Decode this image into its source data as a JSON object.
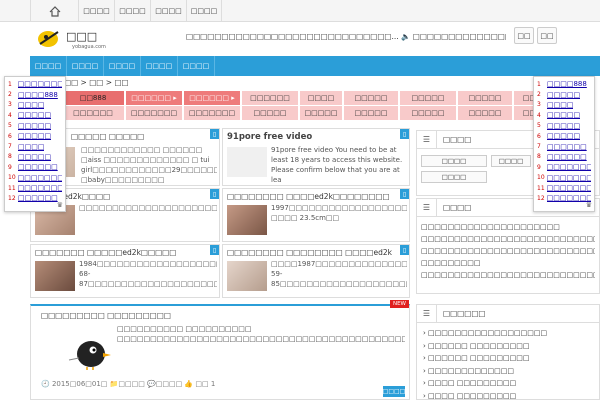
{
  "topnav": {
    "items": [
      "□□□□",
      "□□□□",
      "□□□□",
      "□□□□"
    ]
  },
  "header": {
    "ticker": "□□□□□□□□□□□□□□□□□□□□□□□□□□□□□...  🔈 □□□□□□□□□□□□□□□□□□□□□□□□...",
    "btn1": "□□",
    "btn2": "□□",
    "logo_sub": "yobagua.com"
  },
  "mainnav": {
    "items": [
      "□□□□",
      "□□□□",
      "□□□□",
      "□□□□",
      "□□□□"
    ]
  },
  "left_list": [
    {
      "n": "1",
      "t": "□□□□□□□"
    },
    {
      "n": "2",
      "t": "□□□□888"
    },
    {
      "n": "3",
      "t": "□□□□"
    },
    {
      "n": "4",
      "t": "□□□□□"
    },
    {
      "n": "5",
      "t": "□□□□□"
    },
    {
      "n": "6",
      "t": "□□□□□"
    },
    {
      "n": "7",
      "t": "□□□□"
    },
    {
      "n": "8",
      "t": "□□□□□"
    },
    {
      "n": "9",
      "t": "□□□□□□"
    },
    {
      "n": "10",
      "t": "□□□□□□□"
    },
    {
      "n": "11",
      "t": "□□□□□□□"
    },
    {
      "n": "12",
      "t": "□□□□□□"
    }
  ],
  "right_list": [
    {
      "n": "1",
      "t": "□□□□888"
    },
    {
      "n": "2",
      "t": "□□□□□"
    },
    {
      "n": "3",
      "t": "□□□□"
    },
    {
      "n": "4",
      "t": "□□□□□"
    },
    {
      "n": "5",
      "t": "□□□□□"
    },
    {
      "n": "6",
      "t": "□□□□□"
    },
    {
      "n": "7",
      "t": "□□□□□□"
    },
    {
      "n": "8",
      "t": "□□□□□□"
    },
    {
      "n": "9",
      "t": "□□□□□□□"
    },
    {
      "n": "10",
      "t": "□□□□□□□"
    },
    {
      "n": "11",
      "t": "□□□□□□□"
    },
    {
      "n": "12",
      "t": "□□□□□□□"
    }
  ],
  "breadcrumb": "□□ > □□ > □□",
  "tags_row1": [
    "□□888",
    "□□□□□□ ▸",
    "□□□□□□ ▸",
    "□□□□□□",
    "□□□□",
    "□□□□□",
    "□□□□□",
    "□□□□□",
    "□□□□"
  ],
  "tags_row2": [
    "□□□□□□",
    "□□□□□□□",
    "□□□□□□□",
    "□□□□□",
    "□□□□□",
    "□□□□□",
    "□□□□□",
    "□□□□□",
    "□□□□"
  ],
  "cards": [
    {
      "title": "□□□□□ □□□□□",
      "desc": "□□□□□□□□□□□□ □□□□□□ □aiss □□□□□□□□□□□□□ □ tui girl□□□□□□□□□□□□29□□□□□□□□□□baby□□□□□□□□□□ □baby□□□□□□□□□"
    },
    {
      "title": "91pore free video",
      "desc": "91pore free video You need to be at least 18 years to access this website. Please confirm below that you are at lea"
    },
    {
      "title": "□□□□ed2k□□□□",
      "desc": "□□□□□□□□□□□□□□□□□□□□□□□□□□□□□□□□□□□□□□□□□□□□□□□□□□□□□□□□□□□□□□□□□□□□□□□□□□"
    },
    {
      "title": "□□□□□□□□ □□□□ed2k□□□□□□□□",
      "desc": "1997□□□□□□□□□□□□□□□□□□□□□□□□□□□□□□□□□□□□□□□□□□□□/162.0cm/□□□□ 23.5cm□□"
    },
    {
      "title": "□□□□□□□ □□□□□ed2k□□□□□",
      "desc": "1984□□□□□□□□□□□□□□□□□□□□□1□68□□□□□□□□□□□□□□□□□□□□□□□□88-68-87□□□□□□□□□□□□□□□□□□□□□□□□□□□□□□"
    },
    {
      "title": "□□□□□□□□ □□□□□□□□ □□□□ed2k",
      "desc": "□□□□1987□□□□□□□□□□□□□□□□□□□□□□□□□□□□□□1□6□□□□□□□□89-59-85□□□□□□□□□□□□□□□□□□□□□□□□□"
    }
  ],
  "feature": {
    "title": "□□□□□□□□□ □□□□□□□□□",
    "badge": "NEW",
    "desc": "□□□□□□□□□□ □□□□□□□□□□ □□□□□□□□□□□□□□□□□□□□□□□□□□□□□□□□□□□□□□□□□□□□□□□□□□□□□□□□□□□□□□□□□□□□□□□□□□□□□□□□□□□□□□□□□□□□□□□□□□□□□□□□□□...",
    "meta": "🕘 2015□06□01□ 📁□□□□ 💬□□□□ 👍 □□ 1",
    "more": "□□□□"
  },
  "sidebar": {
    "box1": {
      "title": "□□□□",
      "b1": "□□□□",
      "b2": "□□□□",
      "b3": "□□□□"
    },
    "box2": {
      "title": "□□□□",
      "text": "□□□□□□□□□□□□□□□□□□□□□ □□□□□□□□□□□□□□□□□□□□□□□□□□□□□ □□□□□□□□□□□□□□□□□□□□□□□□□□□□□□ □□□□□□□□□ □□□□□□□□□□□□□□□□□□□□□□□□□□□"
    },
    "box3": {
      "title": "□□□□□□",
      "links": [
        "› □□□□□□□□□□□□□□□□□□",
        "› □□□□□□ □□□□□□□□□",
        "› □□□□□□ □□□□□□□□□",
        "› □□□□□□□□□□□□□",
        "› □□□□ □□□□□□□□□",
        "› □□□□ □□□□□□□□□",
        "› □□□□ □□□□□□□□□"
      ]
    }
  },
  "colors": {
    "accent": "#2b9ed8",
    "tag_light": "#f8caca",
    "tag_dark": "#ee7b7b",
    "badge": "#e02020"
  }
}
